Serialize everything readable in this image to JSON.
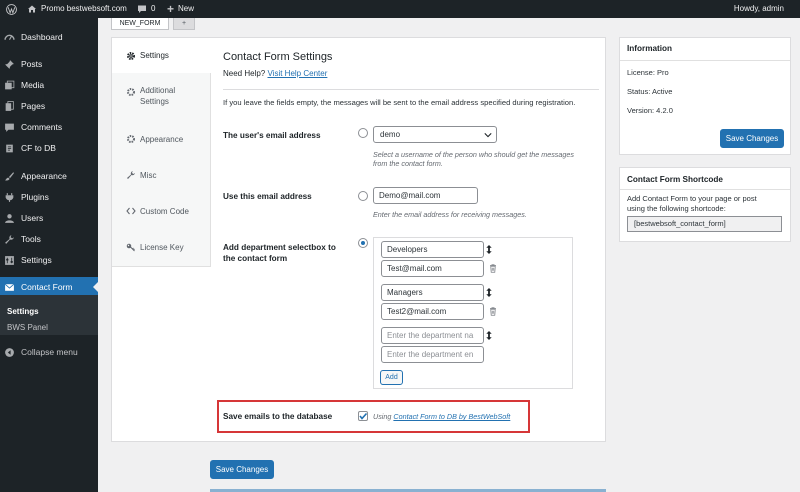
{
  "adminbar": {
    "site_name": "Promo bestwebsoft.com",
    "comments_count": "0",
    "new_label": "New",
    "howdy": "Howdy, admin"
  },
  "sidebar": {
    "items": [
      {
        "label": "Dashboard",
        "icon": "dashboard-icon"
      },
      {
        "label": "Posts",
        "icon": "pushpin-icon"
      },
      {
        "label": "Media",
        "icon": "media-icon"
      },
      {
        "label": "Pages",
        "icon": "page-icon"
      },
      {
        "label": "Comments",
        "icon": "comment-icon"
      },
      {
        "label": "CF to DB",
        "icon": "database-icon"
      },
      {
        "label": "Appearance",
        "icon": "brush-icon"
      },
      {
        "label": "Plugins",
        "icon": "plug-icon"
      },
      {
        "label": "Users",
        "icon": "user-icon"
      },
      {
        "label": "Tools",
        "icon": "wrench-icon"
      },
      {
        "label": "Settings",
        "icon": "settings-icon"
      },
      {
        "label": "Contact Form",
        "icon": "mail-icon"
      }
    ],
    "submenu": [
      "Settings",
      "BWS Panel"
    ],
    "collapse_label": "Collapse menu"
  },
  "form_tabs": [
    "NEW_FORM",
    "+"
  ],
  "settings_tabs": [
    {
      "label": "Settings",
      "icon": "gear-icon"
    },
    {
      "label": "Additional Settings",
      "icon": "gears-icon"
    },
    {
      "label": "Appearance",
      "icon": "gear-icon"
    },
    {
      "label": "Misc",
      "icon": "wrench-icon"
    },
    {
      "label": "Custom Code",
      "icon": "code-icon"
    },
    {
      "label": "License Key",
      "icon": "key-icon"
    }
  ],
  "main": {
    "title": "Contact Form Settings",
    "help_prefix": "Need Help?",
    "help_link": "Visit Help Center",
    "intro": "If you leave the fields empty, the messages will be sent to the email address specified during registration.",
    "user_email": {
      "label": "The user's email address",
      "selected": "demo",
      "desc_line1": "Select a username of the person who should get the messages",
      "desc_line2": "from the contact form."
    },
    "custom_email": {
      "label": "Use this email address",
      "value": "Demo@mail.com",
      "desc": "Enter the email address for receiving messages."
    },
    "department": {
      "label_line1": "Add department selectbox to",
      "label_line2": "the contact form",
      "rows": [
        {
          "name": "Developers",
          "email": "Test@mail.com"
        },
        {
          "name": "Managers",
          "email": "Test2@mail.com"
        }
      ],
      "name_placeholder": "Enter the department na",
      "email_placeholder": "Enter the department en",
      "add_label": "Add"
    },
    "save_db": {
      "label": "Save emails to the database",
      "prefix": "Using",
      "link": "Contact Form to DB by BestWebSoft"
    },
    "save_button": "Save Changes"
  },
  "info_panel": {
    "title": "Information",
    "license": "License: Pro",
    "status": "Status: Active",
    "version": "Version: 4.2.0",
    "save_button": "Save Changes"
  },
  "shortcode_panel": {
    "title": "Contact Form Shortcode",
    "desc_line1": "Add Contact Form to your page or post",
    "desc_line2": "using the following shortcode:",
    "shortcode": "[bestwebsoft_contact_form]"
  },
  "colors": {
    "accent": "#2271b1",
    "highlight": "#d63638"
  }
}
